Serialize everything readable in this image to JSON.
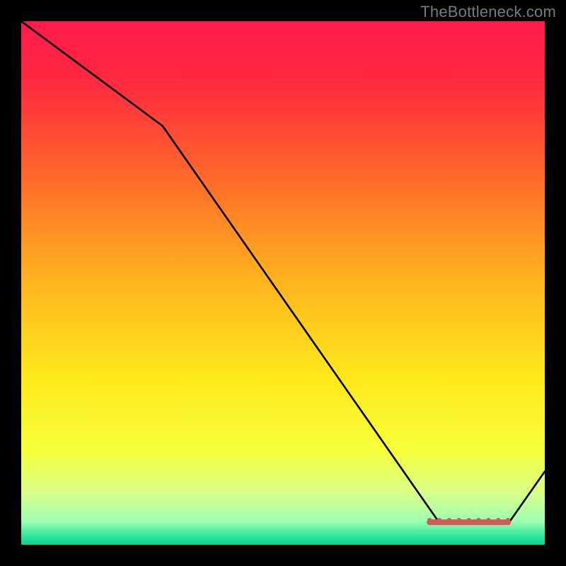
{
  "watermark": "TheBottleneck.com",
  "chart_data": {
    "type": "line",
    "title": "",
    "xlabel": "",
    "ylabel": "",
    "xlim": [
      0,
      100
    ],
    "ylim": [
      0,
      100
    ],
    "x": [
      0,
      27,
      80,
      93,
      100
    ],
    "values": [
      100,
      80,
      4,
      4,
      14
    ],
    "gradient_stops": [
      {
        "offset": 0,
        "color": "#ff1a4a"
      },
      {
        "offset": 0.12,
        "color": "#ff2a3f"
      },
      {
        "offset": 0.3,
        "color": "#ff6a2b"
      },
      {
        "offset": 0.5,
        "color": "#ffb51e"
      },
      {
        "offset": 0.68,
        "color": "#ffe81a"
      },
      {
        "offset": 0.82,
        "color": "#f6ff3a"
      },
      {
        "offset": 0.9,
        "color": "#d8ff8a"
      },
      {
        "offset": 0.955,
        "color": "#9dffb0"
      },
      {
        "offset": 0.985,
        "color": "#28e69a"
      },
      {
        "offset": 1.0,
        "color": "#0ad08a"
      }
    ],
    "marker": {
      "color": "#d25a5a",
      "x_range": [
        78,
        93
      ],
      "y": 4.3
    }
  }
}
